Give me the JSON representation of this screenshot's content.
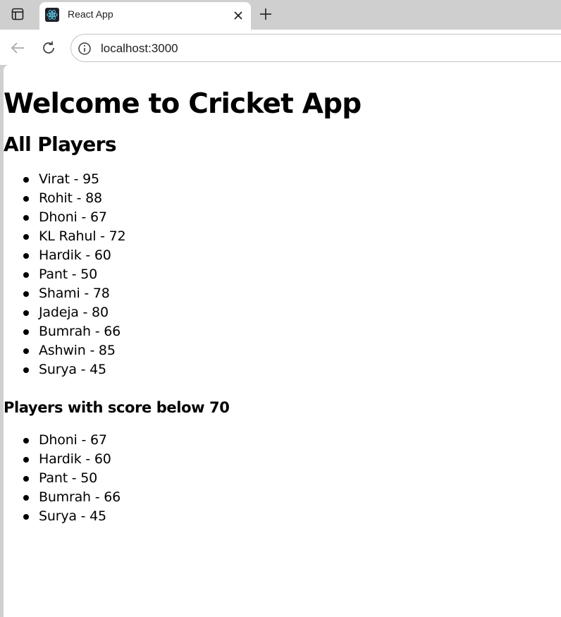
{
  "browser": {
    "tab": {
      "title": "React App"
    },
    "address_bar": {
      "url": "localhost:3000"
    }
  },
  "page": {
    "heading": "Welcome to Cricket App",
    "all_players_heading": "All Players",
    "all_players": [
      "Virat - 95",
      "Rohit - 88",
      "Dhoni - 67",
      "KL Rahul - 72",
      "Hardik - 60",
      "Pant - 50",
      "Shami - 78",
      "Jadeja - 80",
      "Bumrah - 66",
      "Ashwin - 85",
      "Surya - 45"
    ],
    "below_70_heading": "Players with score below 70",
    "below_70_players": [
      "Dhoni - 67",
      "Hardik - 60",
      "Pant - 50",
      "Bumrah - 66",
      "Surya - 45"
    ]
  },
  "icons": {
    "tab_actions": "tab-actions-icon",
    "favicon": "react-logo-icon",
    "close": "close-icon",
    "new_tab": "plus-icon",
    "back": "back-arrow-icon",
    "reload": "reload-icon",
    "site_info": "info-icon"
  },
  "colors": {
    "tab_strip": "#cfcfcf",
    "favicon_bg": "#20232a",
    "react_blue": "#61dafb"
  }
}
